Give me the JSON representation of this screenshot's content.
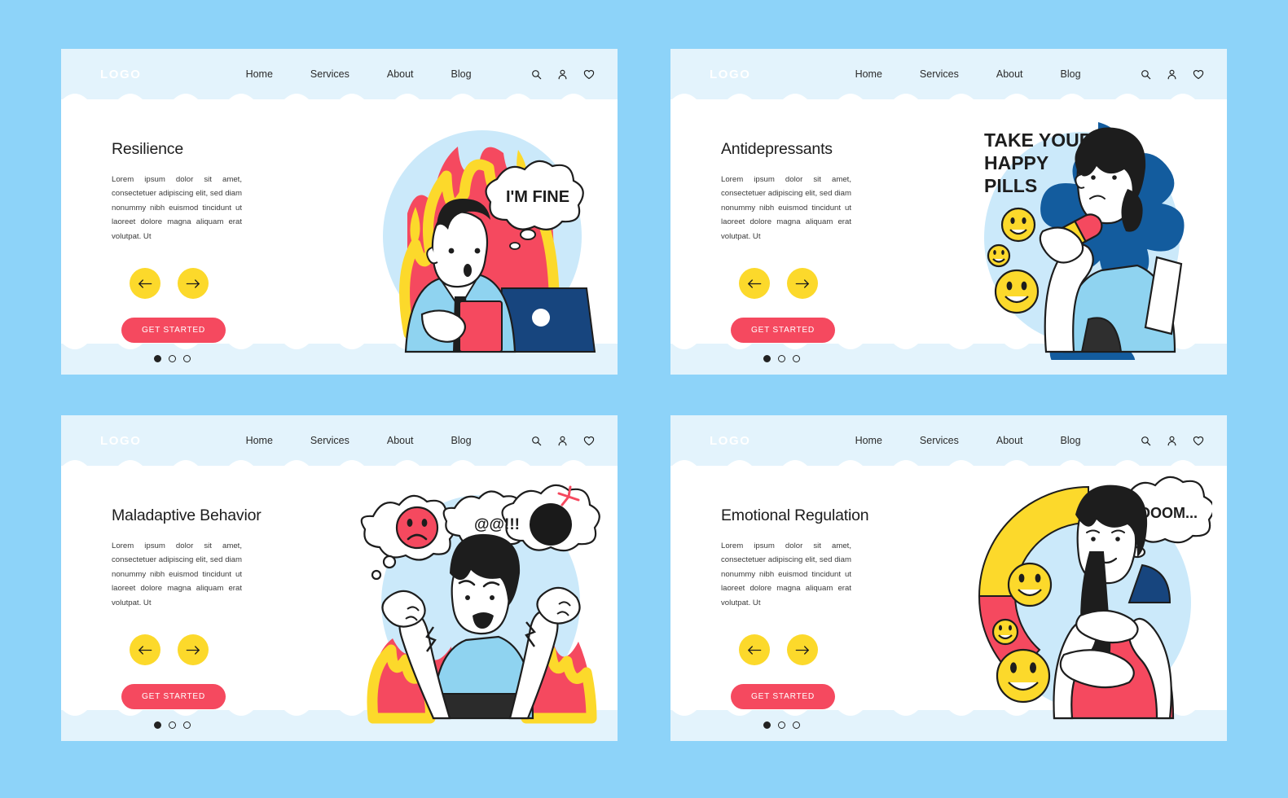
{
  "background_color": "#8DD3F9",
  "theme": {
    "card_bg": "#FFFFFF",
    "band_bg": "#E3F3FC",
    "accent_yellow": "#FCD92B",
    "accent_pink": "#F5495F",
    "accent_blue": "#8DD3F9",
    "accent_navy": "#17457E",
    "text_dark": "#1D1D1D"
  },
  "nav": {
    "logo": "LOGO",
    "links": [
      {
        "label": "Home"
      },
      {
        "label": "Services"
      },
      {
        "label": "About"
      },
      {
        "label": "Blog"
      }
    ],
    "icons": [
      {
        "name": "search-icon"
      },
      {
        "name": "user-icon"
      },
      {
        "name": "heart-icon"
      }
    ]
  },
  "shared": {
    "body_text": "Lorem ipsum dolor sit amet, consectetuer adipiscing elit, sed diam nonummy nibh euismod tincidunt ut laoreet dolore magna aliquam erat volutpat. Ut",
    "cta_label": "GET STARTED",
    "prev_label": "←",
    "next_label": "→",
    "dots": {
      "total": 3,
      "active_index": 0
    }
  },
  "cards": [
    {
      "id": "resilience",
      "title": "Resilience",
      "illustration": {
        "name": "burnout-man-on-fire",
        "bubble_text": "I'M FINE",
        "description": "Man in blue shirt and tie holding a red notebook at a laptop, surrounded by red and yellow flames"
      }
    },
    {
      "id": "antidepressants",
      "title": "Antidepressants",
      "illustration": {
        "name": "woman-holding-pill",
        "headline_lines": [
          "TAKE YOUR",
          "HAPPY",
          "PILLS"
        ],
        "description": "Sad woman with long dark hair holding a large yellow and pink capsule, dark blue splashes, three yellow smiley faces"
      }
    },
    {
      "id": "maladaptive-behavior",
      "title": "Maladaptive Behavior",
      "illustration": {
        "name": "angry-woman-thought-bubbles",
        "bubble_text": "@@!!!",
        "bubbles": [
          "sad-face-icon",
          "@@!!!",
          "bomb-icon"
        ],
        "description": "Shouting woman in light blue shirt with raised fists, three thought bubbles and flames behind"
      }
    },
    {
      "id": "emotional-regulation",
      "title": "Emotional Regulation",
      "illustration": {
        "name": "calm-woman-meditating",
        "bubble_text": "OOOM...",
        "description": "Calm smiling woman in pink shirt hugging herself, yellow and pink arc gauge, three yellow smiley faces"
      }
    }
  ]
}
